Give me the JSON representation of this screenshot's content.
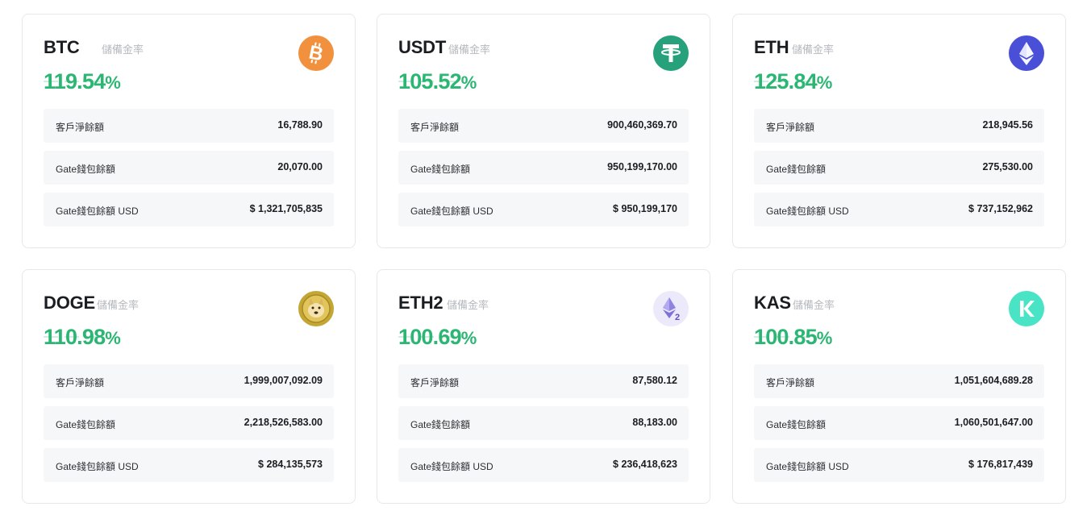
{
  "cards": [
    {
      "symbol": "BTC",
      "rate_label": "儲備金率",
      "ratio": "119.54",
      "pct": "%",
      "icon": "bitcoin-icon",
      "icon_color": "#f2913d",
      "rows": [
        {
          "label": "客戶淨餘額",
          "value": "16,788.90"
        },
        {
          "label": "Gate錢包餘額",
          "value": "20,070.00"
        },
        {
          "label": "Gate錢包餘額 USD",
          "value": "$ 1,321,705,835"
        }
      ]
    },
    {
      "symbol": "USDT",
      "rate_label": "儲備金率",
      "ratio": "105.52",
      "pct": "%",
      "icon": "tether-icon",
      "icon_color": "#26a17b",
      "rows": [
        {
          "label": "客戶淨餘額",
          "value": "900,460,369.70"
        },
        {
          "label": "Gate錢包餘額",
          "value": "950,199,170.00"
        },
        {
          "label": "Gate錢包餘額 USD",
          "value": "$ 950,199,170"
        }
      ]
    },
    {
      "symbol": "ETH",
      "rate_label": "儲備金率",
      "ratio": "125.84",
      "pct": "%",
      "icon": "ethereum-icon",
      "icon_color": "#4a4fd8",
      "rows": [
        {
          "label": "客戶淨餘額",
          "value": "218,945.56"
        },
        {
          "label": "Gate錢包餘額",
          "value": "275,530.00"
        },
        {
          "label": "Gate錢包餘額 USD",
          "value": "$ 737,152,962"
        }
      ]
    },
    {
      "symbol": "DOGE",
      "rate_label": "儲備金率",
      "ratio": "110.98",
      "pct": "%",
      "icon": "dogecoin-icon",
      "icon_color": "#c3a634",
      "rows": [
        {
          "label": "客戶淨餘額",
          "value": "1,999,007,092.09"
        },
        {
          "label": "Gate錢包餘額",
          "value": "2,218,526,583.00"
        },
        {
          "label": "Gate錢包餘額 USD",
          "value": "$ 284,135,573"
        }
      ]
    },
    {
      "symbol": "ETH2",
      "rate_label": "儲備金率",
      "ratio": "100.69",
      "pct": "%",
      "icon": "eth2-icon",
      "icon_color": "#ece9fb",
      "icon_badge": "2",
      "rows": [
        {
          "label": "客戶淨餘額",
          "value": "87,580.12"
        },
        {
          "label": "Gate錢包餘額",
          "value": "88,183.00"
        },
        {
          "label": "Gate錢包餘額 USD",
          "value": "$ 236,418,623"
        }
      ]
    },
    {
      "symbol": "KAS",
      "rate_label": "儲備金率",
      "ratio": "100.85",
      "pct": "%",
      "icon": "kaspa-icon",
      "icon_color": "#49e3c5",
      "rows": [
        {
          "label": "客戶淨餘額",
          "value": "1,051,604,689.28"
        },
        {
          "label": "Gate錢包餘額",
          "value": "1,060,501,647.00"
        },
        {
          "label": "Gate錢包餘額 USD",
          "value": "$ 176,817,439"
        }
      ]
    }
  ]
}
